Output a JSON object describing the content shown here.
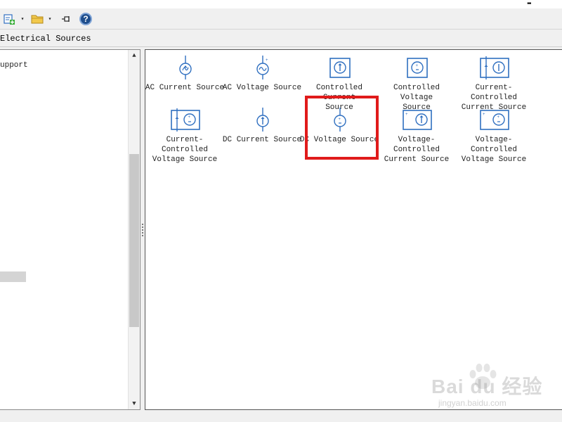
{
  "colors": {
    "accent_blue": "#2f6fc0",
    "highlight_red": "#e01b1b",
    "help_blue": "#1f4e8c"
  },
  "window": {
    "control_glyph": "▬"
  },
  "toolbar": {
    "new_model_icon": "new-model-icon",
    "open_icon": "folder-open-icon",
    "pin_icon": "pin-icon",
    "help_icon": "help-icon",
    "help_glyph": "?",
    "dropdown_glyph": "▾"
  },
  "panel": {
    "title": "Electrical Sources"
  },
  "tree": {
    "items": [
      {
        "label": "upport"
      }
    ],
    "scroll_up_glyph": "▲",
    "scroll_down_glyph": "▼"
  },
  "library": {
    "blocks": [
      {
        "label": "AC Current Source",
        "icon": "ac-current-source-icon"
      },
      {
        "label": "AC Voltage Source",
        "icon": "ac-voltage-source-icon"
      },
      {
        "label": "Controlled Current\nSource",
        "icon": "controlled-current-source-icon"
      },
      {
        "label": "Controlled Voltage\nSource",
        "icon": "controlled-voltage-source-icon"
      },
      {
        "label": "Current-Controlled\nCurrent Source",
        "icon": "current-controlled-current-source-icon"
      },
      {
        "label": "Current-Controlled\nVoltage Source",
        "icon": "current-controlled-voltage-source-icon"
      },
      {
        "label": "DC Current Source",
        "icon": "dc-current-source-icon"
      },
      {
        "label": "DC Voltage Source",
        "icon": "dc-voltage-source-icon"
      },
      {
        "label": "Voltage-Controlled\nCurrent Source",
        "icon": "voltage-controlled-current-source-icon"
      },
      {
        "label": "Voltage-Controlled\nVoltage Source",
        "icon": "voltage-controlled-voltage-source-icon"
      }
    ]
  },
  "watermark": {
    "brand": "Bai du 经验",
    "url": "jingyan.baidu.com"
  }
}
